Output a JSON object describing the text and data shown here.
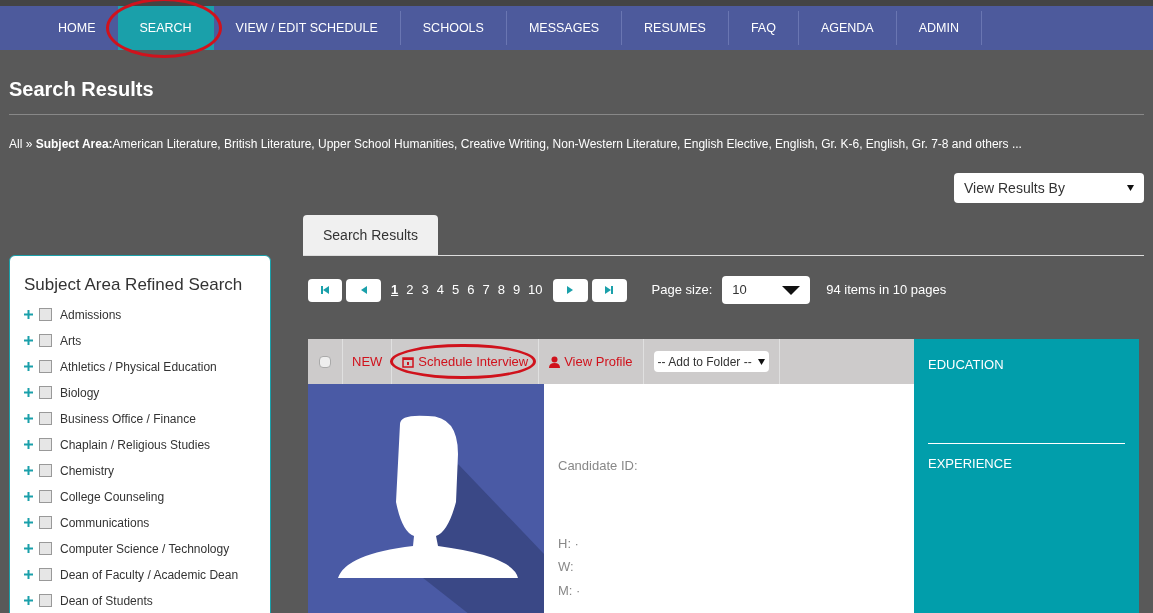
{
  "nav": [
    {
      "label": "HOME",
      "selected": false,
      "circled": false
    },
    {
      "label": "SEARCH",
      "selected": true,
      "circled": true
    },
    {
      "label": "VIEW / EDIT SCHEDULE",
      "selected": false,
      "circled": false
    },
    {
      "label": "SCHOOLS",
      "selected": false,
      "circled": false
    },
    {
      "label": "MESSAGES",
      "selected": false,
      "circled": false
    },
    {
      "label": "RESUMES",
      "selected": false,
      "circled": false
    },
    {
      "label": "FAQ",
      "selected": false,
      "circled": false
    },
    {
      "label": "AGENDA",
      "selected": false,
      "circled": false
    },
    {
      "label": "ADMIN",
      "selected": false,
      "circled": false
    }
  ],
  "page_title": "Search Results",
  "breadcrumb": "All » **Subject Area:**American Literature, British Literature, Upper School Humanities, Creative Writing, Non-Western Literature, English Elective, English, Gr. K-6, English, Gr. 7-8 and others ...",
  "view_results_by": {
    "value": "View Results By"
  },
  "refine": {
    "title": "Subject Area Refined Search",
    "items": [
      {
        "label": "Admissions",
        "checked": false
      },
      {
        "label": "Arts",
        "checked": false
      },
      {
        "label": "Athletics / Physical Education",
        "checked": false
      },
      {
        "label": "Biology",
        "checked": false
      },
      {
        "label": "Business Office / Finance",
        "checked": false
      },
      {
        "label": "Chaplain / Religious Studies",
        "checked": false
      },
      {
        "label": "Chemistry",
        "checked": false
      },
      {
        "label": "College Counseling",
        "checked": false
      },
      {
        "label": "Communications",
        "checked": false
      },
      {
        "label": "Computer Science / Technology",
        "checked": false
      },
      {
        "label": "Dean of Faculty / Academic Dean",
        "checked": false
      },
      {
        "label": "Dean of Students",
        "checked": false
      }
    ]
  },
  "tabs": [
    {
      "label": "Search Results",
      "selected": true
    }
  ],
  "pager": {
    "pages": [
      {
        "label": "1",
        "selected": true
      },
      {
        "label": "2",
        "selected": false
      },
      {
        "label": "3",
        "selected": false
      },
      {
        "label": "4",
        "selected": false
      },
      {
        "label": "5",
        "selected": false
      },
      {
        "label": "6",
        "selected": false
      },
      {
        "label": "7",
        "selected": false
      },
      {
        "label": "8",
        "selected": false
      },
      {
        "label": "9",
        "selected": false
      },
      {
        "label": "10",
        "selected": false
      }
    ],
    "page_size_label": "Page size:",
    "page_size": "10",
    "summary": "94 items in 10 pages"
  },
  "result": {
    "checked": false,
    "new": "NEW",
    "schedule": {
      "label": "Schedule Interview",
      "circled": true
    },
    "view_profile": "View Profile",
    "folder": "-- Add to Folder --",
    "candidate_id": "Candidate ID:",
    "phones": [
      "H: ·",
      "W:",
      "M: ·"
    ],
    "education": "EDUCATION",
    "experience": "EXPERIENCE"
  }
}
